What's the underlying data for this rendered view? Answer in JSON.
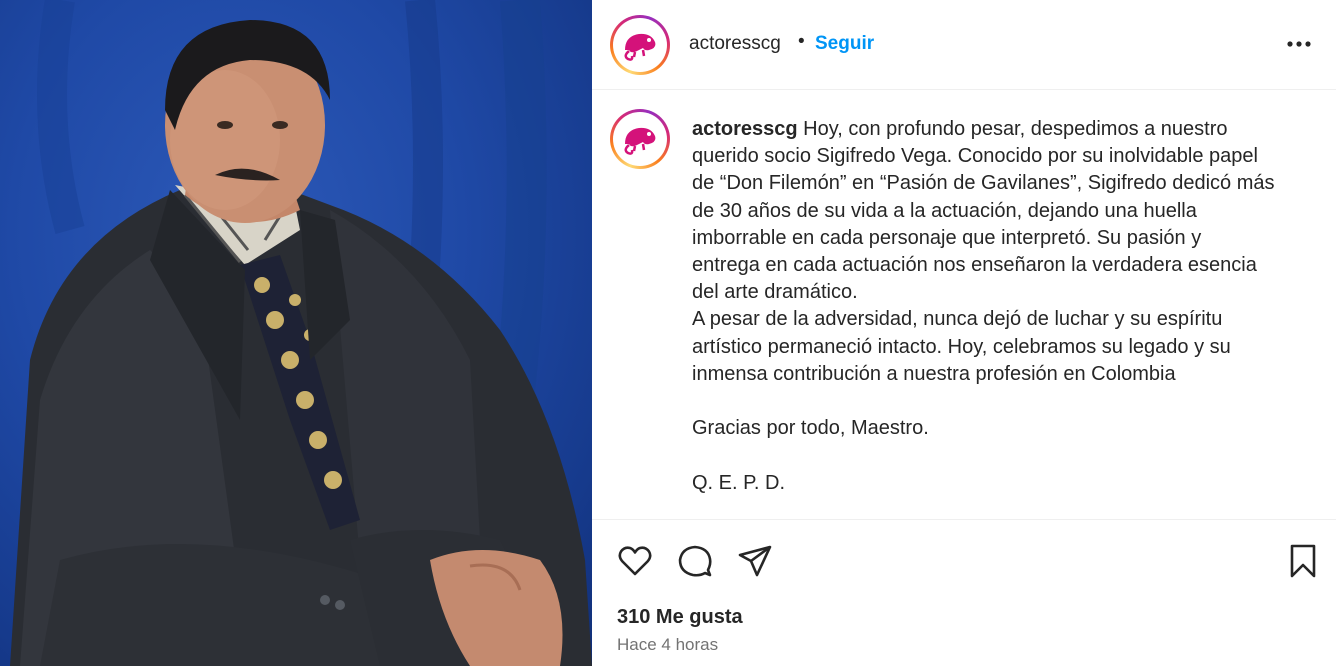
{
  "post": {
    "username": "actoresscg",
    "separator": "•",
    "follow_label": "Seguir",
    "more_icon": "more-horizontal-icon",
    "avatar_icon": "chameleon-logo",
    "photo": "portrait-of-man-in-suit"
  },
  "caption": {
    "username": "actoresscg",
    "lines": [
      " Hoy, con profundo pesar, despedimos a nuestro",
      "querido socio Sigifredo Vega. Conocido por su inolvidable papel",
      "de “Don Filemón” en “Pasión de Gavilanes”, Sigifredo dedicó más",
      "de 30 años de su vida a la actuación, dejando una huella",
      "imborrable en cada personaje que interpretó. Su pasión y",
      "entrega en cada actuación nos enseñaron la verdadera esencia",
      "del arte dramático.",
      "A pesar de la adversidad, nunca dejó de luchar y su espíritu",
      "artístico permaneció intacto. Hoy, celebramos su legado y su",
      "inmensa contribución a nuestra profesión en Colombia",
      " ",
      "Gracias por todo, Maestro.",
      " ",
      "Q. E. P. D."
    ]
  },
  "actions": {
    "like_icon": "heart-icon",
    "comment_icon": "comment-icon",
    "share_icon": "send-icon",
    "save_icon": "bookmark-icon",
    "likes_text": "310 Me gusta",
    "time_text": "Hace 4 horas"
  },
  "colors": {
    "follow": "#0095f6",
    "background_photo": "#1f49a6",
    "avatar_logo": "#d4127a"
  }
}
